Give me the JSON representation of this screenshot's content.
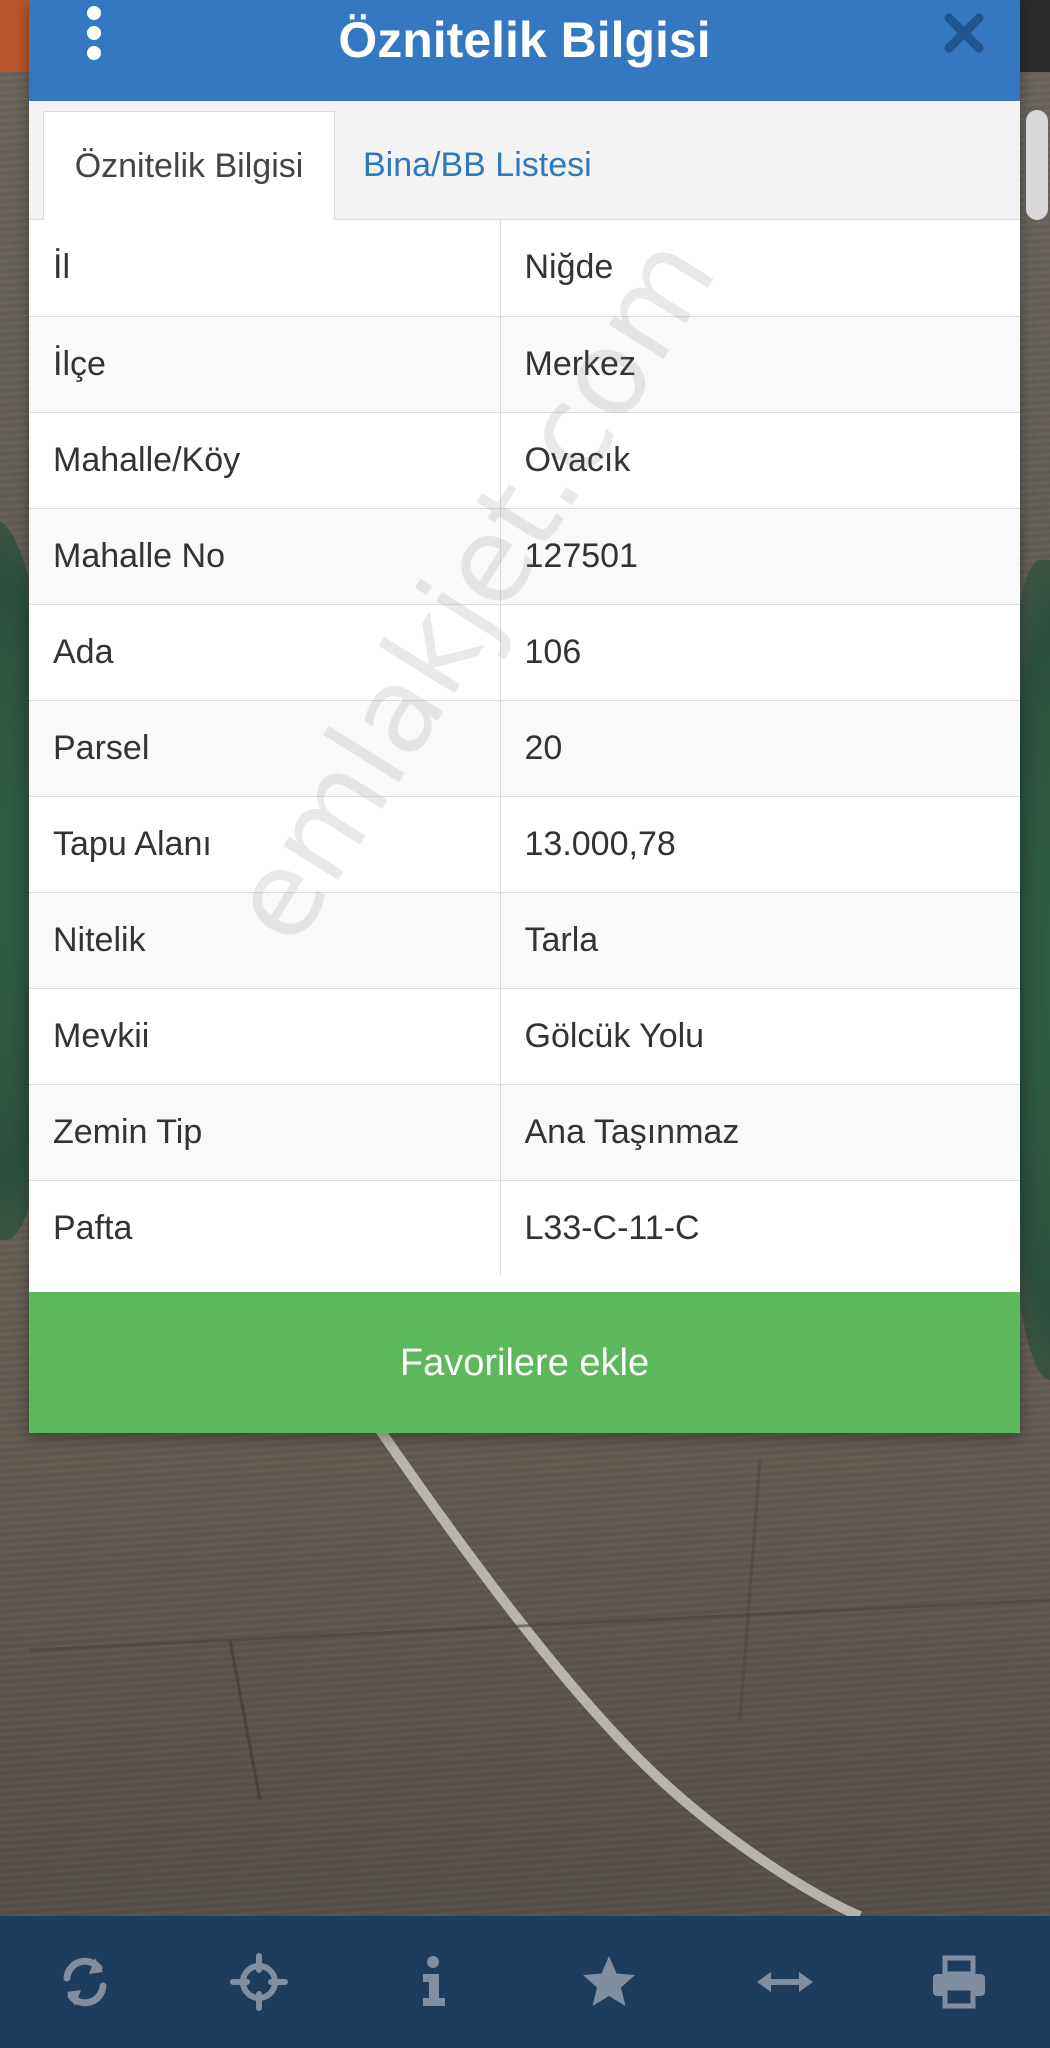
{
  "modal": {
    "title": "Öznitelik Bilgisi",
    "tabs": [
      {
        "label": "Öznitelik Bilgisi",
        "active": true
      },
      {
        "label": "Bina/BB Listesi",
        "active": false
      }
    ],
    "rows": [
      {
        "key": "İl",
        "value": "Niğde"
      },
      {
        "key": "İlçe",
        "value": "Merkez"
      },
      {
        "key": "Mahalle/Köy",
        "value": "Ovacık"
      },
      {
        "key": "Mahalle No",
        "value": "127501"
      },
      {
        "key": "Ada",
        "value": "106"
      },
      {
        "key": "Parsel",
        "value": "20"
      },
      {
        "key": "Tapu Alanı",
        "value": "13.000,78"
      },
      {
        "key": "Nitelik",
        "value": "Tarla"
      },
      {
        "key": "Mevkii",
        "value": "Gölcük Yolu"
      },
      {
        "key": "Zemin Tip",
        "value": "Ana Taşınmaz"
      },
      {
        "key": "Pafta",
        "value": "L33-C-11-C"
      }
    ],
    "favorite_label": "Favorilere ekle"
  },
  "watermark": "emlakjet.com",
  "toolbar": {
    "icons": [
      "refresh-icon",
      "locate-icon",
      "info-icon",
      "star-icon",
      "measure-icon",
      "print-icon"
    ]
  },
  "colors": {
    "header": "#3478c2",
    "tab_link": "#2f78bd",
    "favorite_button": "#5cb85c",
    "toolbar": "#1d3d5f"
  }
}
